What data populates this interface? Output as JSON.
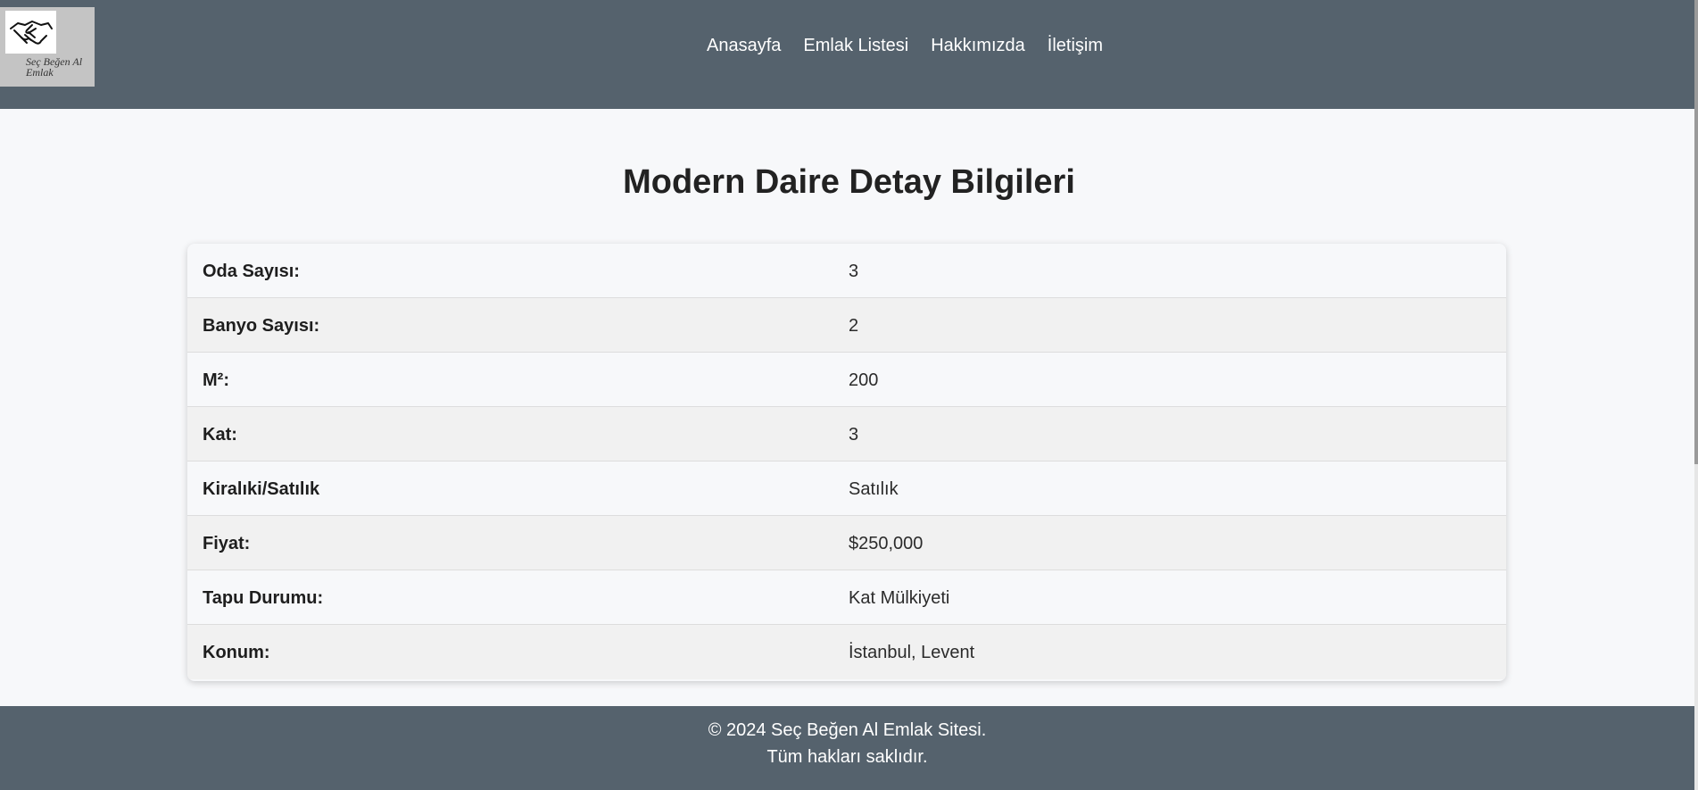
{
  "logo": {
    "text": "Seç Beğen Al Emlak",
    "icon": "handshake-icon"
  },
  "nav": {
    "items": [
      {
        "label": "Anasayfa"
      },
      {
        "label": "Emlak Listesi"
      },
      {
        "label": "Hakkımızda"
      },
      {
        "label": "İletişim"
      }
    ]
  },
  "page": {
    "title": "Modern Daire Detay Bilgileri"
  },
  "details": [
    {
      "label": "Oda Sayısı:",
      "value": "3"
    },
    {
      "label": "Banyo Sayısı:",
      "value": "2"
    },
    {
      "label": "M²:",
      "value": "200"
    },
    {
      "label": "Kat:",
      "value": "3"
    },
    {
      "label": "Kiralıki/Satılık",
      "value": "Satılık"
    },
    {
      "label": "Fiyat:",
      "value": "$250,000"
    },
    {
      "label": "Tapu Durumu:",
      "value": "Kat Mülkiyeti"
    },
    {
      "label": "Konum:",
      "value": "İstanbul, Levent"
    }
  ],
  "footer": {
    "line1": "© 2024 Seç Beğen Al Emlak Sitesi.",
    "line2": "Tüm hakları saklıdır."
  },
  "colors": {
    "header_bg": "#55626d",
    "footer_bg": "#55626d",
    "page_bg": "#f7f8fa",
    "row_alt_bg": "#f1f1f1"
  }
}
